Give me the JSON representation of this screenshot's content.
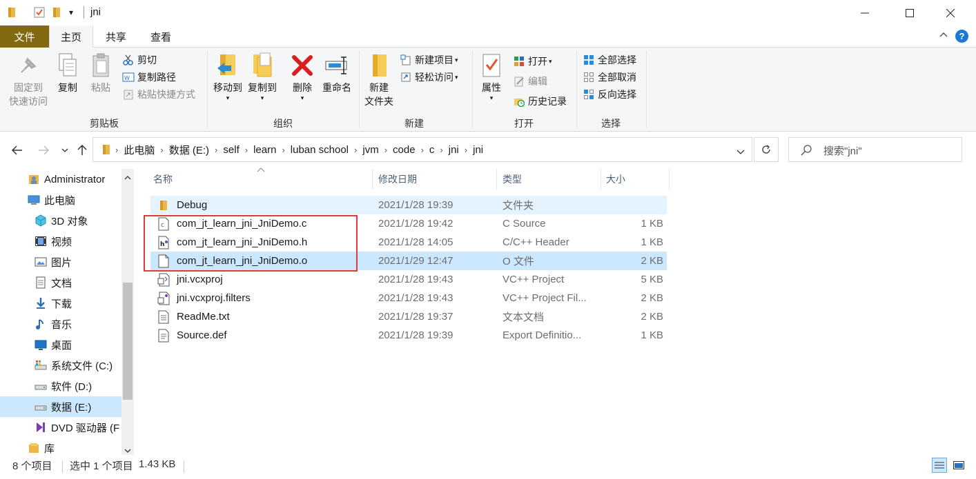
{
  "titlebar": {
    "title": "jni",
    "customize_arrow": "▾",
    "minimize": "—",
    "maximize": "☐",
    "close": "✕"
  },
  "tabs": {
    "file": "文件",
    "home": "主页",
    "share": "共享",
    "view": "查看",
    "collapse": "^",
    "help": "?"
  },
  "ribbon": {
    "clipboard": {
      "label": "剪贴板",
      "pin_line1": "固定到",
      "pin_line2": "快速访问",
      "copy": "复制",
      "paste": "粘贴",
      "cut": "剪切",
      "copy_path": "复制路径",
      "paste_shortcut": "粘贴快捷方式"
    },
    "organize": {
      "label": "组织",
      "move_to": "移动到",
      "copy_to": "复制到",
      "delete": "删除",
      "rename": "重命名"
    },
    "new": {
      "label": "新建",
      "new_folder_line1": "新建",
      "new_folder_line2": "文件夹",
      "new_item": "新建项目",
      "easy_access": "轻松访问"
    },
    "open": {
      "label": "打开",
      "properties": "属性",
      "open": "打开",
      "edit": "编辑",
      "history": "历史记录"
    },
    "select": {
      "label": "选择",
      "select_all": "全部选择",
      "select_none": "全部取消",
      "invert": "反向选择"
    }
  },
  "address": {
    "crumbs": [
      "此电脑",
      "数据 (E:)",
      "self",
      "learn",
      "luban school",
      "jvm",
      "code",
      "c",
      "jni",
      "jni"
    ],
    "search_placeholder": "搜索\"jni\""
  },
  "navpane": {
    "items": [
      {
        "label": "Administrator",
        "icon": "user-folder-icon",
        "indent": 0
      },
      {
        "label": "此电脑",
        "icon": "computer-icon",
        "indent": 0
      },
      {
        "label": "3D 对象",
        "icon": "3d-objects-icon",
        "indent": 1
      },
      {
        "label": "视频",
        "icon": "video-icon",
        "indent": 1
      },
      {
        "label": "图片",
        "icon": "pictures-icon",
        "indent": 1
      },
      {
        "label": "文档",
        "icon": "documents-icon",
        "indent": 1
      },
      {
        "label": "下载",
        "icon": "download-icon",
        "indent": 1
      },
      {
        "label": "音乐",
        "icon": "music-icon",
        "indent": 1
      },
      {
        "label": "桌面",
        "icon": "desktop-icon",
        "indent": 1
      },
      {
        "label": "系统文件 (C:)",
        "icon": "system-drive-icon",
        "indent": 1
      },
      {
        "label": "软件 (D:)",
        "icon": "drive-icon",
        "indent": 1
      },
      {
        "label": "数据 (E:)",
        "icon": "drive-icon",
        "indent": 1,
        "selected": true
      },
      {
        "label": "DVD 驱动器 (F",
        "icon": "dvd-drive-icon",
        "indent": 1
      },
      {
        "label": "库",
        "icon": "library-icon",
        "indent": 0
      }
    ]
  },
  "filelist": {
    "headers": {
      "name": "名称",
      "date": "修改日期",
      "type": "类型",
      "size": "大小"
    },
    "rows": [
      {
        "name": "Debug",
        "date": "2021/1/28 19:39",
        "type": "文件夹",
        "size": "",
        "icon": "folder-icon",
        "state": "hover"
      },
      {
        "name": "com_jt_learn_jni_JniDemo.c",
        "date": "2021/1/28 19:42",
        "type": "C Source",
        "size": "1 KB",
        "icon": "c-source-icon",
        "state": ""
      },
      {
        "name": "com_jt_learn_jni_JniDemo.h",
        "date": "2021/1/28 14:05",
        "type": "C/C++ Header",
        "size": "1 KB",
        "icon": "header-file-icon",
        "state": ""
      },
      {
        "name": "com_jt_learn_jni_JniDemo.o",
        "date": "2021/1/29 12:47",
        "type": "O 文件",
        "size": "2 KB",
        "icon": "blank-file-icon",
        "state": "selected"
      },
      {
        "name": "jni.vcxproj",
        "date": "2021/1/28 19:43",
        "type": "VC++ Project",
        "size": "5 KB",
        "icon": "vcxproj-icon",
        "state": ""
      },
      {
        "name": "jni.vcxproj.filters",
        "date": "2021/1/28 19:43",
        "type": "VC++ Project Fil...",
        "size": "2 KB",
        "icon": "filters-file-icon",
        "state": ""
      },
      {
        "name": "ReadMe.txt",
        "date": "2021/1/28 19:37",
        "type": "文本文档",
        "size": "2 KB",
        "icon": "text-file-icon",
        "state": ""
      },
      {
        "name": "Source.def",
        "date": "2021/1/28 19:39",
        "type": "Export Definitio...",
        "size": "1 KB",
        "icon": "def-file-icon",
        "state": ""
      }
    ]
  },
  "statusbar": {
    "item_count": "8 个项目",
    "selected": "选中 1 个项目",
    "selected_size": "1.43 KB"
  },
  "colors": {
    "file_tab": "#836a12",
    "selection": "#cce8ff",
    "hover": "#e5f3ff",
    "annotation_box": "#e0393e"
  }
}
